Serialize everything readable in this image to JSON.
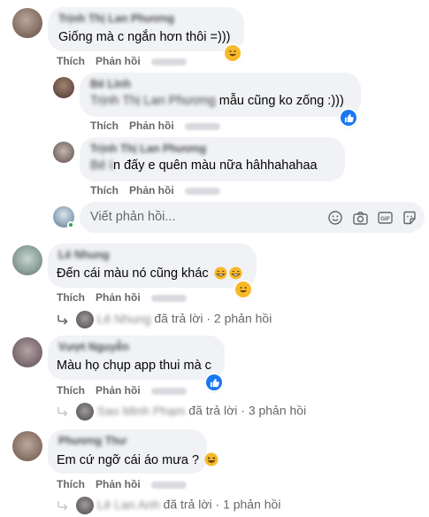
{
  "actions": {
    "like": "Thích",
    "reply": "Phản hồi"
  },
  "comments": [
    {
      "name": "Trịnh Thị Lan Phương",
      "text": "Giống mà c ngắn hơn thôi =)))",
      "reaction": "laugh"
    },
    {
      "name": "Bé Linh",
      "mention": "Trịnh Thị Lan Phương",
      "text": " mẫu cũng ko zống :)))",
      "reaction": "like"
    },
    {
      "name": "Trịnh Thị Lan Phương",
      "mention": "Bé Linh",
      "text": "n đấy e quên màu nữa hâhhahahaa"
    },
    {
      "name": "Lê Nhung",
      "text": "Đến cái màu nó cũng khác",
      "reaction": "laugh"
    },
    {
      "name": "Vượt Nguyễn",
      "text": "Màu họ chụp app thui mà c",
      "reaction": "like"
    },
    {
      "name": "Phương Thư",
      "text": "Em cứ ngỡ cái áo mưa ?",
      "reaction": "laugh"
    }
  ],
  "reply_input": {
    "placeholder": "Viết phản hồi..."
  },
  "replies_summary": [
    {
      "name": "Lê Nhung",
      "text": " đã trả lời · 2 phản hồi"
    },
    {
      "name": "Sao Minh Phạm",
      "text": " đã trả lời · 3 phản hồi"
    },
    {
      "name": "Lê Lan Anh",
      "text": " đã trả lời · 1 phản hồi"
    }
  ],
  "colors": {
    "bubble": "#f0f2f5",
    "link": "#65676b",
    "like": "#1877f2",
    "laugh": "#f7b928"
  }
}
